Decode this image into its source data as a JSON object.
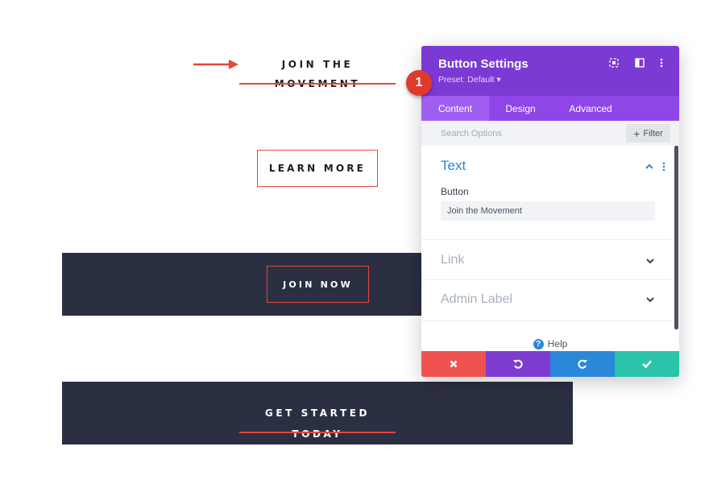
{
  "canvas": {
    "join_movement_label": "Join the Movement",
    "learn_more_label": "Learn More",
    "join_now_label": "Join Now",
    "get_started_label": "Get Started Today"
  },
  "callout": {
    "number": "1"
  },
  "panel": {
    "title": "Button Settings",
    "preset": "Preset: Default ▾",
    "header_icons": [
      "target-icon",
      "split-view-icon",
      "more-vertical-icon"
    ],
    "tabs": [
      {
        "label": "Content",
        "active": true
      },
      {
        "label": "Design",
        "active": false
      },
      {
        "label": "Advanced",
        "active": false
      }
    ],
    "search": {
      "placeholder": "Search Options",
      "value": ""
    },
    "filter": {
      "icon": "+",
      "label": "Filter"
    },
    "groups": {
      "text": {
        "title": "Text",
        "field_label": "Button",
        "field_value": "Join the Movement"
      },
      "link": {
        "title": "Link"
      },
      "admin": {
        "title": "Admin Label"
      }
    },
    "help": {
      "icon": "?",
      "label": "Help"
    },
    "footer": [
      {
        "name": "discard",
        "icon": "close-icon",
        "color": "#ef5350"
      },
      {
        "name": "undo",
        "icon": "undo-icon",
        "color": "#7e3bd0"
      },
      {
        "name": "redo",
        "icon": "redo-icon",
        "color": "#2b87da"
      },
      {
        "name": "save",
        "icon": "check-icon",
        "color": "#29c4a9"
      }
    ]
  },
  "colors": {
    "accent_red": "#e4473b",
    "dark_band": "#2b2f42",
    "panel_purple": "#7c3ad4",
    "tabs_purple": "#8f46e6",
    "open_group_blue": "#2b87da"
  }
}
